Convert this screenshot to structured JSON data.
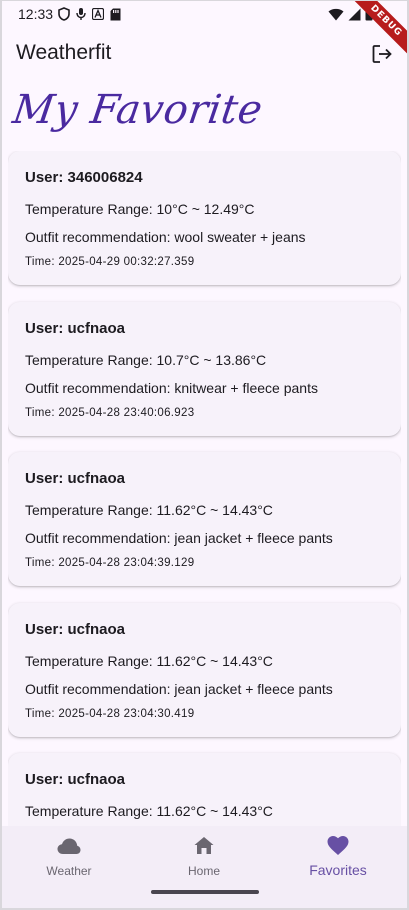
{
  "status_bar": {
    "time": "12:33",
    "debug_label": "DEBUG",
    "left_icons": [
      "shield-icon",
      "mic-icon",
      "a-icon",
      "sd-card-icon"
    ],
    "right_icons": [
      "wifi-icon",
      "signal-icon",
      "battery-icon"
    ]
  },
  "app_bar": {
    "title": "Weatherfit",
    "logout_icon": "logout-icon"
  },
  "page": {
    "heading": "My Favorite"
  },
  "favorites": [
    {
      "user": "User: 346006824",
      "temperature": "Temperature Range: 10°C ~ 12.49°C",
      "outfit": "Outfit recommendation: wool sweater + jeans",
      "time": "Time: 2025-04-29 00:32:27.359"
    },
    {
      "user": "User: ucfnaoa",
      "temperature": "Temperature Range: 10.7°C ~ 13.86°C",
      "outfit": "Outfit recommendation: knitwear + fleece pants",
      "time": "Time: 2025-04-28 23:40:06.923"
    },
    {
      "user": "User: ucfnaoa",
      "temperature": "Temperature Range: 11.62°C ~ 14.43°C",
      "outfit": "Outfit recommendation: jean jacket + fleece pants",
      "time": "Time: 2025-04-28 23:04:39.129"
    },
    {
      "user": "User: ucfnaoa",
      "temperature": "Temperature Range: 11.62°C ~ 14.43°C",
      "outfit": "Outfit recommendation: jean jacket + fleece pants",
      "time": "Time: 2025-04-28 23:04:30.419"
    },
    {
      "user": "User: ucfnaoa",
      "temperature": "Temperature Range: 11.62°C ~ 14.43°C",
      "outfit": "",
      "time": ""
    }
  ],
  "bottom_nav": {
    "items": [
      {
        "label": "Weather",
        "icon": "cloud-icon",
        "active": false
      },
      {
        "label": "Home",
        "icon": "home-icon",
        "active": false
      },
      {
        "label": "Favorites",
        "icon": "heart-icon",
        "active": true
      }
    ]
  },
  "colors": {
    "accent": "#6750a4",
    "heading": "#4a2aa0",
    "background": "#fdf7ff",
    "card": "#f7f2fa",
    "nav_background": "#f3edf7",
    "inactive": "#6a6670"
  }
}
